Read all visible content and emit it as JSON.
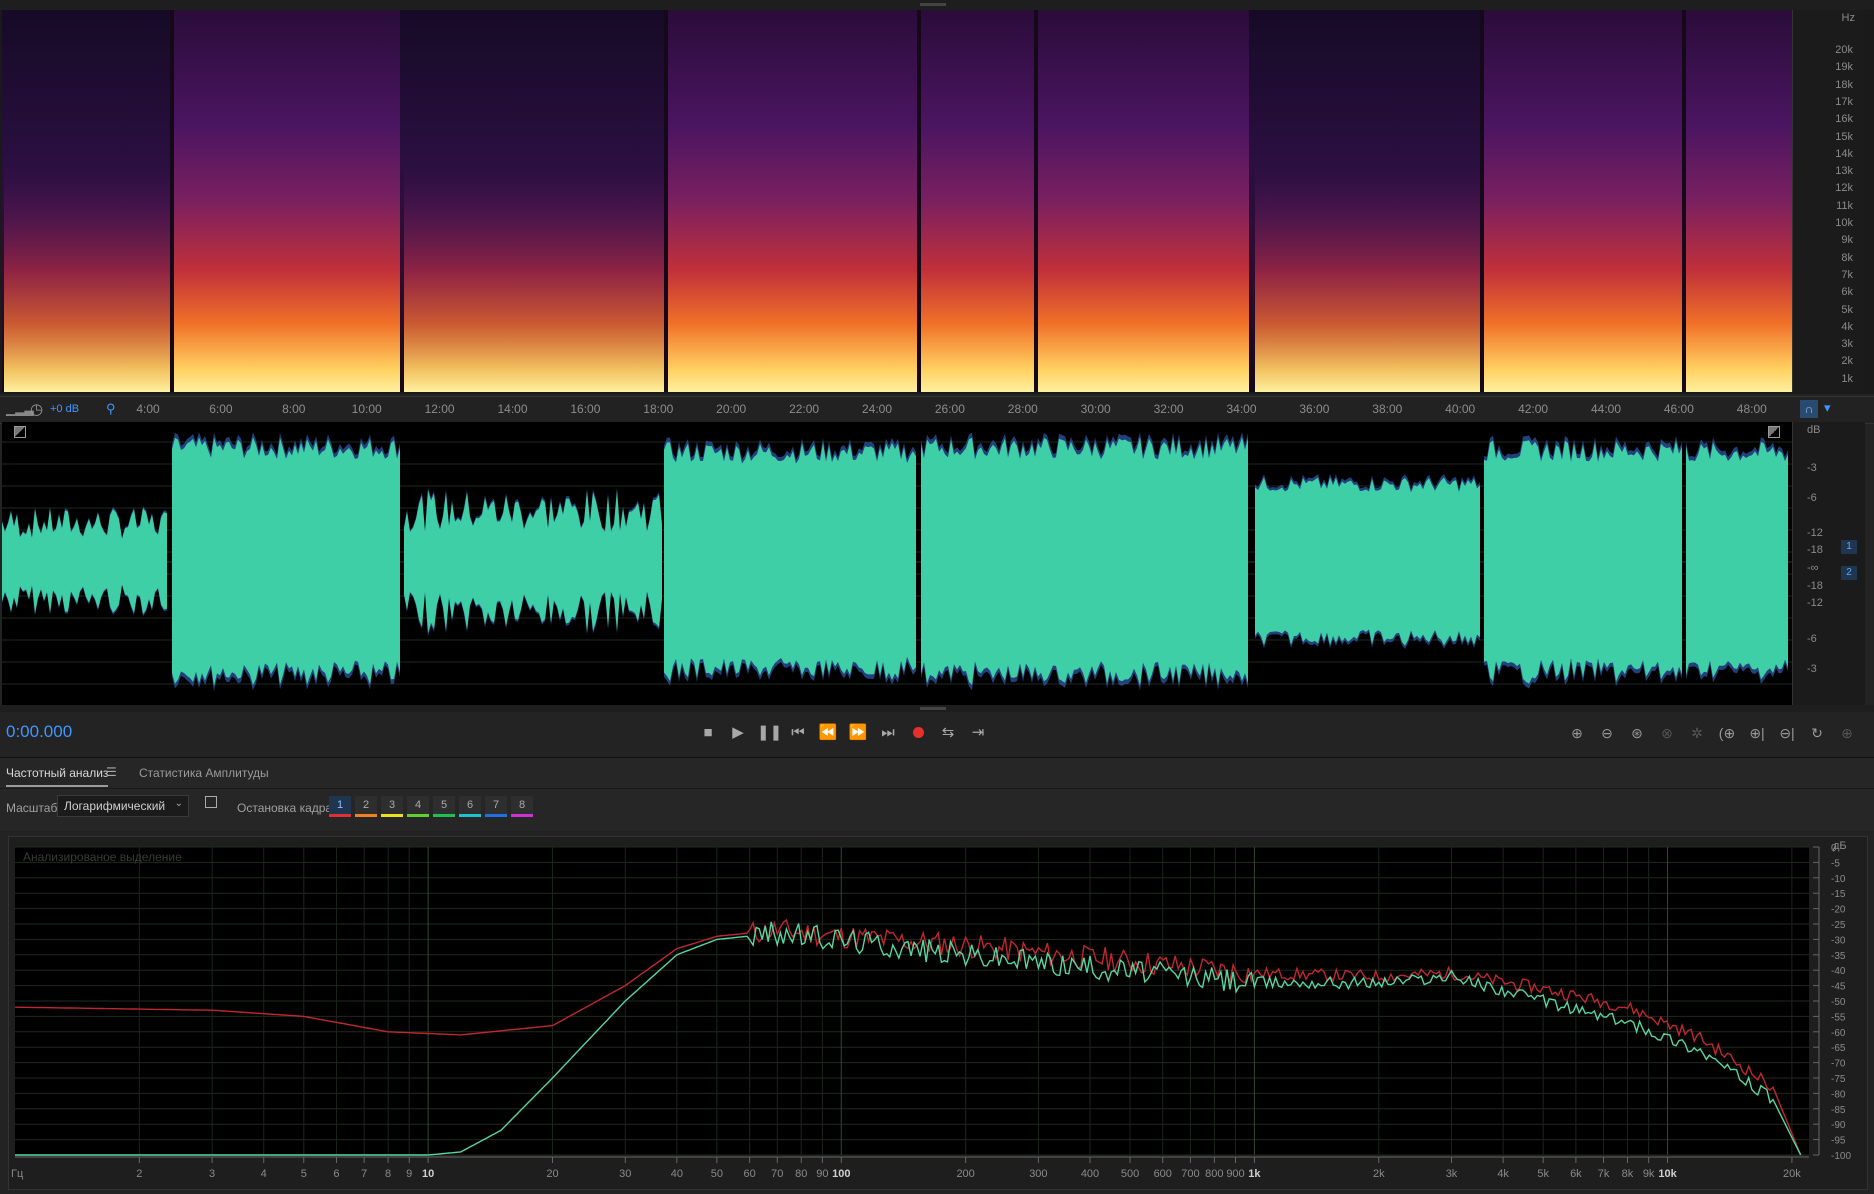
{
  "spectral": {
    "unit": "Hz",
    "freq_labels": [
      "20k",
      "19k",
      "18k",
      "17k",
      "16k",
      "15k",
      "14k",
      "13k",
      "12k",
      "11k",
      "10k",
      "9k",
      "8k",
      "7k",
      "6k",
      "5k",
      "4k",
      "3k",
      "2k",
      "1k"
    ]
  },
  "timeline": {
    "gain_label": "+0 dB",
    "ticks": [
      "4:00",
      "6:00",
      "8:00",
      "10:00",
      "12:00",
      "14:00",
      "16:00",
      "18:00",
      "20:00",
      "22:00",
      "24:00",
      "26:00",
      "28:00",
      "30:00",
      "32:00",
      "34:00",
      "36:00",
      "38:00",
      "40:00",
      "42:00",
      "44:00",
      "46:00",
      "48:00"
    ]
  },
  "waveform": {
    "unit": "dB",
    "db_labels": [
      "-3",
      "-6",
      "-12",
      "-18",
      "-∞",
      "-18",
      "-12",
      "-6",
      "-3"
    ],
    "channels": [
      "1",
      "2"
    ],
    "color": "#3ecfa6"
  },
  "transport": {
    "timecode": "0:00.000",
    "record_color": "#e8302a"
  },
  "panel": {
    "tabs": [
      {
        "label": "Частотный анализ",
        "active": true
      },
      {
        "label": "Статистика Амплитуды",
        "active": false
      }
    ],
    "scale_label": "Масштаб:",
    "scale_value": "Логарифмический",
    "freeze_label": "Остановка кадра:",
    "freeze_frames": [
      {
        "label": "1",
        "color": "#e03030"
      },
      {
        "label": "2",
        "color": "#f08020"
      },
      {
        "label": "3",
        "color": "#e8e020"
      },
      {
        "label": "4",
        "color": "#60d030"
      },
      {
        "label": "5",
        "color": "#20c050"
      },
      {
        "label": "6",
        "color": "#20c0d0"
      },
      {
        "label": "7",
        "color": "#2070e0"
      },
      {
        "label": "8",
        "color": "#d030d0"
      }
    ]
  },
  "analyzer": {
    "watermark": "Анализированое выделение",
    "db_unit": "дБ",
    "db_ticks": [
      "0",
      "-5",
      "-10",
      "-15",
      "-20",
      "-25",
      "-30",
      "-35",
      "-40",
      "-45",
      "-50",
      "-55",
      "-60",
      "-65",
      "-70",
      "-75",
      "-80",
      "-85",
      "-90",
      "-95",
      "-100"
    ],
    "freq_unit": "Гц",
    "freq_ticks": [
      {
        "label": "2",
        "f": 2
      },
      {
        "label": "3",
        "f": 3
      },
      {
        "label": "4",
        "f": 4
      },
      {
        "label": "5",
        "f": 5
      },
      {
        "label": "6",
        "f": 6
      },
      {
        "label": "7",
        "f": 7
      },
      {
        "label": "8",
        "f": 8
      },
      {
        "label": "9",
        "f": 9
      },
      {
        "label": "10",
        "f": 10
      },
      {
        "label": "20",
        "f": 20
      },
      {
        "label": "30",
        "f": 30
      },
      {
        "label": "40",
        "f": 40
      },
      {
        "label": "50",
        "f": 50
      },
      {
        "label": "60",
        "f": 60
      },
      {
        "label": "70",
        "f": 70
      },
      {
        "label": "80",
        "f": 80
      },
      {
        "label": "90",
        "f": 90
      },
      {
        "label": "100",
        "f": 100
      },
      {
        "label": "200",
        "f": 200
      },
      {
        "label": "300",
        "f": 300
      },
      {
        "label": "400",
        "f": 400
      },
      {
        "label": "500",
        "f": 500
      },
      {
        "label": "600",
        "f": 600
      },
      {
        "label": "700",
        "f": 700
      },
      {
        "label": "800",
        "f": 800
      },
      {
        "label": "900",
        "f": 900
      },
      {
        "label": "1k",
        "f": 1000
      },
      {
        "label": "2k",
        "f": 2000
      },
      {
        "label": "3k",
        "f": 3000
      },
      {
        "label": "4k",
        "f": 4000
      },
      {
        "label": "5k",
        "f": 5000
      },
      {
        "label": "6k",
        "f": 6000
      },
      {
        "label": "7k",
        "f": 7000
      },
      {
        "label": "8k",
        "f": 8000
      },
      {
        "label": "9k",
        "f": 9000
      },
      {
        "label": "10k",
        "f": 10000
      },
      {
        "label": "20k",
        "f": 20000
      }
    ],
    "series": [
      {
        "color": "#c0282c",
        "points": [
          [
            1,
            -52
          ],
          [
            3,
            -53
          ],
          [
            5,
            -55
          ],
          [
            8,
            -60
          ],
          [
            12,
            -61
          ],
          [
            20,
            -58
          ],
          [
            30,
            -45
          ],
          [
            40,
            -33
          ],
          [
            50,
            -29
          ],
          [
            70,
            -27
          ],
          [
            100,
            -29
          ],
          [
            200,
            -32
          ],
          [
            400,
            -36
          ],
          [
            700,
            -39
          ],
          [
            1000,
            -41
          ],
          [
            2000,
            -42
          ],
          [
            3000,
            -41
          ],
          [
            5000,
            -46
          ],
          [
            8000,
            -52
          ],
          [
            12000,
            -62
          ],
          [
            18000,
            -78
          ],
          [
            21000,
            -100
          ]
        ]
      },
      {
        "color": "#56d6a0",
        "points": [
          [
            1,
            -100
          ],
          [
            10,
            -100
          ],
          [
            12,
            -99
          ],
          [
            15,
            -92
          ],
          [
            20,
            -75
          ],
          [
            30,
            -50
          ],
          [
            40,
            -35
          ],
          [
            50,
            -30
          ],
          [
            70,
            -28
          ],
          [
            100,
            -30
          ],
          [
            200,
            -35
          ],
          [
            400,
            -39
          ],
          [
            700,
            -42
          ],
          [
            1000,
            -44
          ],
          [
            2000,
            -44
          ],
          [
            3000,
            -42
          ],
          [
            5000,
            -50
          ],
          [
            8000,
            -57
          ],
          [
            12000,
            -66
          ],
          [
            18000,
            -82
          ],
          [
            21000,
            -100
          ]
        ]
      }
    ]
  }
}
